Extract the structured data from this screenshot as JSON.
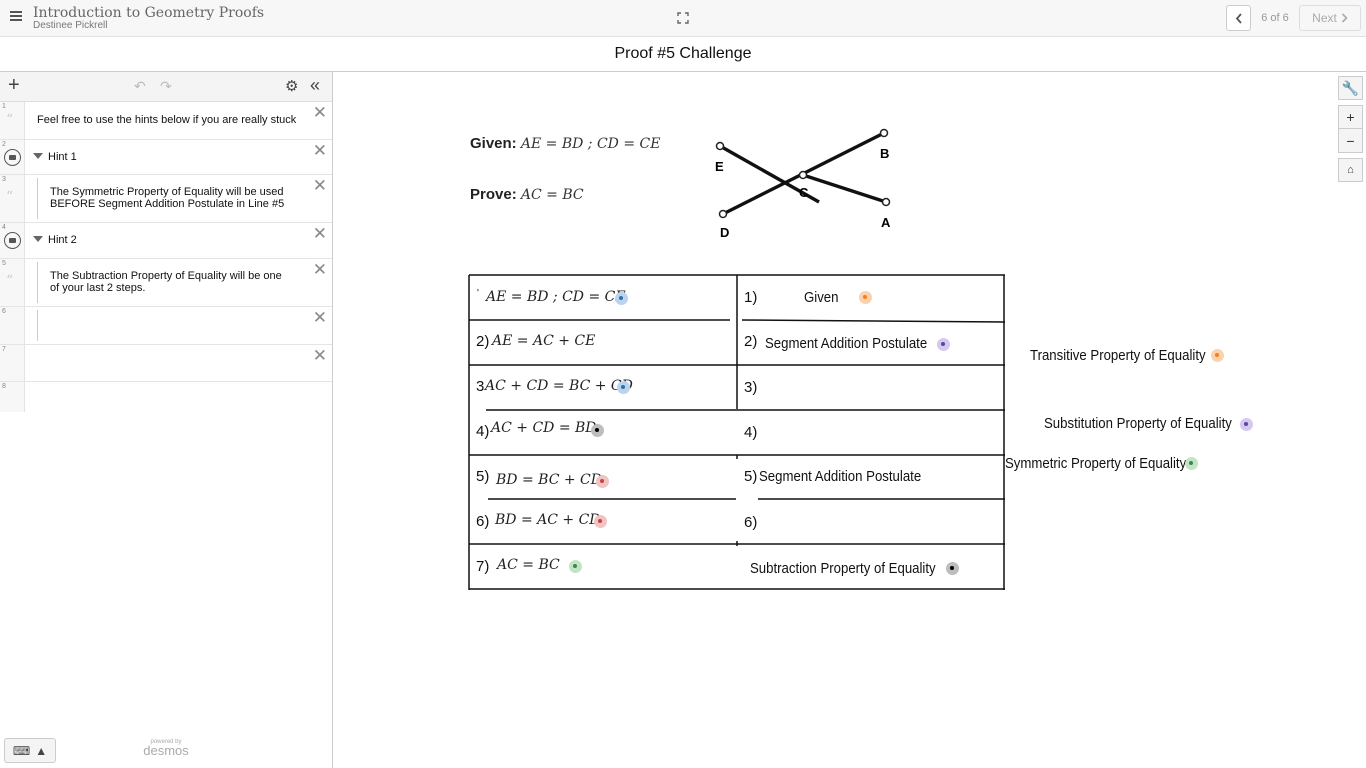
{
  "header": {
    "title": "Introduction to Geometry Proofs",
    "author": "Destinee Pickrell",
    "page_counter": "6 of 6",
    "next_label": "Next"
  },
  "screen_title": "Proof #5 Challenge",
  "sidebar": {
    "expressions": [
      {
        "num": "1",
        "text": "Feel free to use the hints below if you are really stuck"
      },
      {
        "num": "2",
        "folder": "Hint 1"
      },
      {
        "num": "3",
        "text": "The Symmetric Property of Equality will be used BEFORE Segment Addition Postulate in Line #5"
      },
      {
        "num": "4",
        "folder": "Hint 2"
      },
      {
        "num": "5",
        "text": "The Subtraction Property of Equality will be one of your last 2 steps."
      },
      {
        "num": "6",
        "text": ""
      },
      {
        "num": "7",
        "text": ""
      },
      {
        "num": "8",
        "text": ""
      }
    ],
    "powered_by": "powered by",
    "brand": "desmos"
  },
  "graph": {
    "given_label": "Given:",
    "given_math": "AE = BD ;  CD = CE",
    "prove_label": "Prove:",
    "prove_math": "AC = BC",
    "figure_points": [
      "E",
      "B",
      "C",
      "D",
      "A"
    ],
    "statements": [
      {
        "num": "'",
        "math": "AE = BD ;  CD = CE",
        "dot": "blue"
      },
      {
        "num": "2)",
        "math": "AE = AC + CE",
        "dot": ""
      },
      {
        "num": "3",
        "math": "AC + CD = BC + CD",
        "dot": "blue"
      },
      {
        "num": "4)",
        "math": "AC + CD = BD",
        "dot": "gray"
      },
      {
        "num": "5)",
        "math": "BD = BC + CD",
        "dot": "red"
      },
      {
        "num": "6)",
        "math": "BD = AC + CD",
        "dot": "red"
      },
      {
        "num": "7)",
        "math": "AC = BC",
        "dot": "green"
      }
    ],
    "reasons": [
      {
        "num": "1)",
        "text": "Given",
        "dot": "orange"
      },
      {
        "num": "2)",
        "text": "Segment Addition Postulate",
        "dot": "purple"
      },
      {
        "num": "3)",
        "text": "",
        "dot": ""
      },
      {
        "num": "4)",
        "text": "",
        "dot": ""
      },
      {
        "num": "5)",
        "text": "Segment Addition Postulate",
        "dot": ""
      },
      {
        "num": "6)",
        "text": "",
        "dot": ""
      },
      {
        "num": "",
        "text": "Subtraction Property of Equality",
        "dot": "gray"
      }
    ],
    "bank": [
      {
        "text": "Transitive Property of Equality",
        "dot": "orange"
      },
      {
        "text": "Substitution Property of Equality",
        "dot": "purple"
      },
      {
        "text": "Symmetric Property of Equality",
        "dot": "green"
      }
    ],
    "tools": [
      "wrench-icon",
      "zoom-in-icon",
      "zoom-out-icon",
      "home-icon"
    ],
    "colors": {
      "blue": "#2d70b3",
      "orange": "#fa7e19",
      "purple": "#6042a6",
      "black": "#000000",
      "red": "#c74440",
      "green": "#388c46"
    }
  }
}
